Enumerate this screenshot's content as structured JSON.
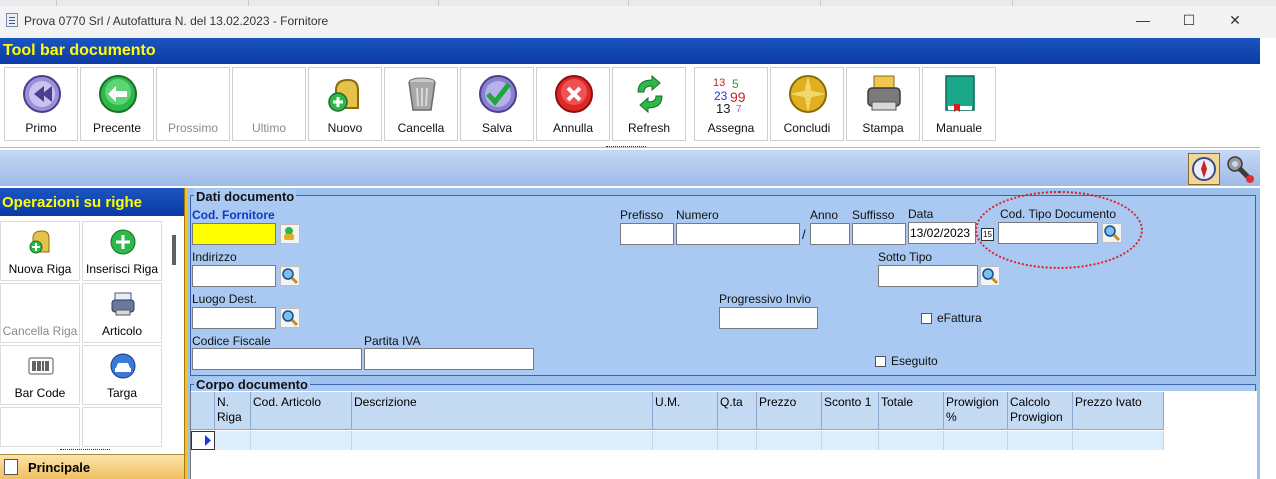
{
  "window": {
    "title": "Prova 0770 Srl / Autofattura N.  del 13.02.2023 - Fornitore",
    "minimize": "—",
    "maximize": "☐",
    "close": "✕"
  },
  "toolbar": {
    "title": "Tool bar documento",
    "buttons": [
      {
        "label": "Primo",
        "icon": "rewind-icon",
        "enabled": true
      },
      {
        "label": "Precente",
        "icon": "back-arrow-icon",
        "enabled": true
      },
      {
        "label": "Prossimo",
        "icon": "",
        "enabled": false
      },
      {
        "label": "Ultimo",
        "icon": "",
        "enabled": false
      },
      {
        "label": "Nuovo",
        "icon": "new-bell-icon",
        "enabled": true
      },
      {
        "label": "Cancella",
        "icon": "trash-icon",
        "enabled": true
      },
      {
        "label": "Salva",
        "icon": "checkmark-icon",
        "enabled": true
      },
      {
        "label": "Annulla",
        "icon": "cancel-icon",
        "enabled": true
      },
      {
        "label": "Refresh",
        "icon": "refresh-icon",
        "enabled": true
      },
      {
        "label": "Assegna",
        "icon": "numbers-icon",
        "enabled": true
      },
      {
        "label": "Concludi",
        "icon": "gold-disc-icon",
        "enabled": true
      },
      {
        "label": "Stampa",
        "icon": "printer-icon",
        "enabled": true
      },
      {
        "label": "Manuale",
        "icon": "book-icon",
        "enabled": true
      }
    ]
  },
  "left_panel": {
    "title": "Operazioni su righe",
    "buttons": [
      {
        "label": "Nuova Riga",
        "enabled": true
      },
      {
        "label": "Inserisci Riga",
        "enabled": true
      },
      {
        "label": "Cancella Riga",
        "enabled": false
      },
      {
        "label": "Articolo",
        "enabled": true
      },
      {
        "label": "Bar Code",
        "enabled": true
      },
      {
        "label": "Targa",
        "enabled": true
      }
    ],
    "footer": "Principale"
  },
  "dati_documento": {
    "title": "Dati documento",
    "cod_fornitore": {
      "label": "Cod. Fornitore",
      "value": ""
    },
    "prefisso": {
      "label": "Prefisso",
      "value": ""
    },
    "numero": {
      "label": "Numero",
      "value": ""
    },
    "slash": "/",
    "anno": {
      "label": "Anno",
      "value": ""
    },
    "suffisso": {
      "label": "Suffisso",
      "value": ""
    },
    "data": {
      "label": "Data",
      "value": "13/02/2023",
      "calendar_icon": "15"
    },
    "cod_tipo_documento": {
      "label": "Cod. Tipo Documento",
      "value": ""
    },
    "indirizzo": {
      "label": "Indirizzo",
      "value": ""
    },
    "sotto_tipo": {
      "label": "Sotto Tipo",
      "value": ""
    },
    "luogo_dest": {
      "label": "Luogo Dest.",
      "value": ""
    },
    "progressivo_invio": {
      "label": "Progressivo Invio",
      "value": ""
    },
    "efattura": {
      "label": "eFattura",
      "checked": false
    },
    "codice_fiscale": {
      "label": "Codice Fiscale",
      "value": ""
    },
    "partita_iva": {
      "label": "Partita IVA",
      "value": ""
    },
    "eseguito": {
      "label": "Eseguito",
      "checked": false
    }
  },
  "corpo_documento": {
    "title": "Corpo documento",
    "columns": [
      "N. Riga",
      "Cod. Articolo",
      "Descrizione",
      "U.M.",
      "Q.ta",
      "Prezzo",
      "Sconto 1",
      "Totale",
      "Prowigion %",
      "Calcolo Prowigion",
      "Prezzo Ivato"
    ]
  },
  "colors": {
    "header_blue": "#0b3aa6",
    "header_text": "#ffff00",
    "form_bg": "#a9c9f2",
    "required_field": "#ffff00",
    "annotation": "#e02020"
  }
}
